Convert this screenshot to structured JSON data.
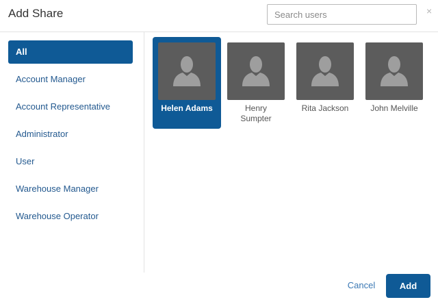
{
  "dialog": {
    "title": "Add Share",
    "close_glyph": "×",
    "close_icon": "close-icon"
  },
  "search": {
    "placeholder": "Search users",
    "value": ""
  },
  "sidebar": {
    "items": [
      {
        "label": "All",
        "active": true
      },
      {
        "label": "Account Manager",
        "active": false
      },
      {
        "label": "Account Representative",
        "active": false
      },
      {
        "label": "Administrator",
        "active": false
      },
      {
        "label": "User",
        "active": false
      },
      {
        "label": "Warehouse Manager",
        "active": false
      },
      {
        "label": "Warehouse Operator",
        "active": false
      }
    ]
  },
  "users": [
    {
      "name": "Helen Adams",
      "selected": true,
      "avatar_icon": "user-silhouette-icon"
    },
    {
      "name": "Henry Sumpter",
      "selected": false,
      "avatar_icon": "user-silhouette-icon"
    },
    {
      "name": "Rita Jackson",
      "selected": false,
      "avatar_icon": "user-silhouette-icon"
    },
    {
      "name": "John Melville",
      "selected": false,
      "avatar_icon": "user-silhouette-icon"
    }
  ],
  "footer": {
    "cancel_label": "Cancel",
    "add_label": "Add"
  },
  "colors": {
    "accent": "#0f5a96",
    "link": "#23598f",
    "avatar_bg": "#5c5c5c",
    "avatar_figure": "#9e9e9e"
  }
}
